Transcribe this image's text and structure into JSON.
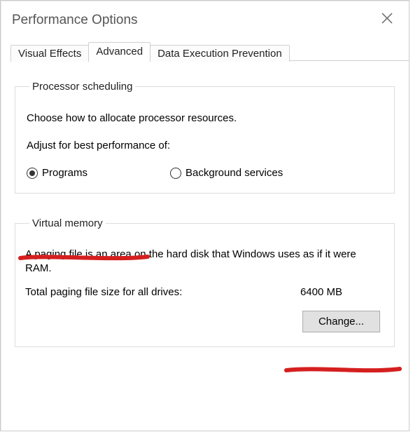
{
  "window": {
    "title": "Performance Options"
  },
  "tabs": {
    "visual_effects": "Visual Effects",
    "advanced": "Advanced",
    "dep": "Data Execution Prevention"
  },
  "processor": {
    "legend": "Processor scheduling",
    "desc": "Choose how to allocate processor resources.",
    "subhead": "Adjust for best performance of:",
    "programs_label": "Programs",
    "services_label": "Background services"
  },
  "vm": {
    "legend": "Virtual memory",
    "desc": "A paging file is an area on the hard disk that Windows uses as if it were RAM.",
    "size_label": "Total paging file size for all drives:",
    "size_value": "6400 MB",
    "change_label": "Change..."
  }
}
